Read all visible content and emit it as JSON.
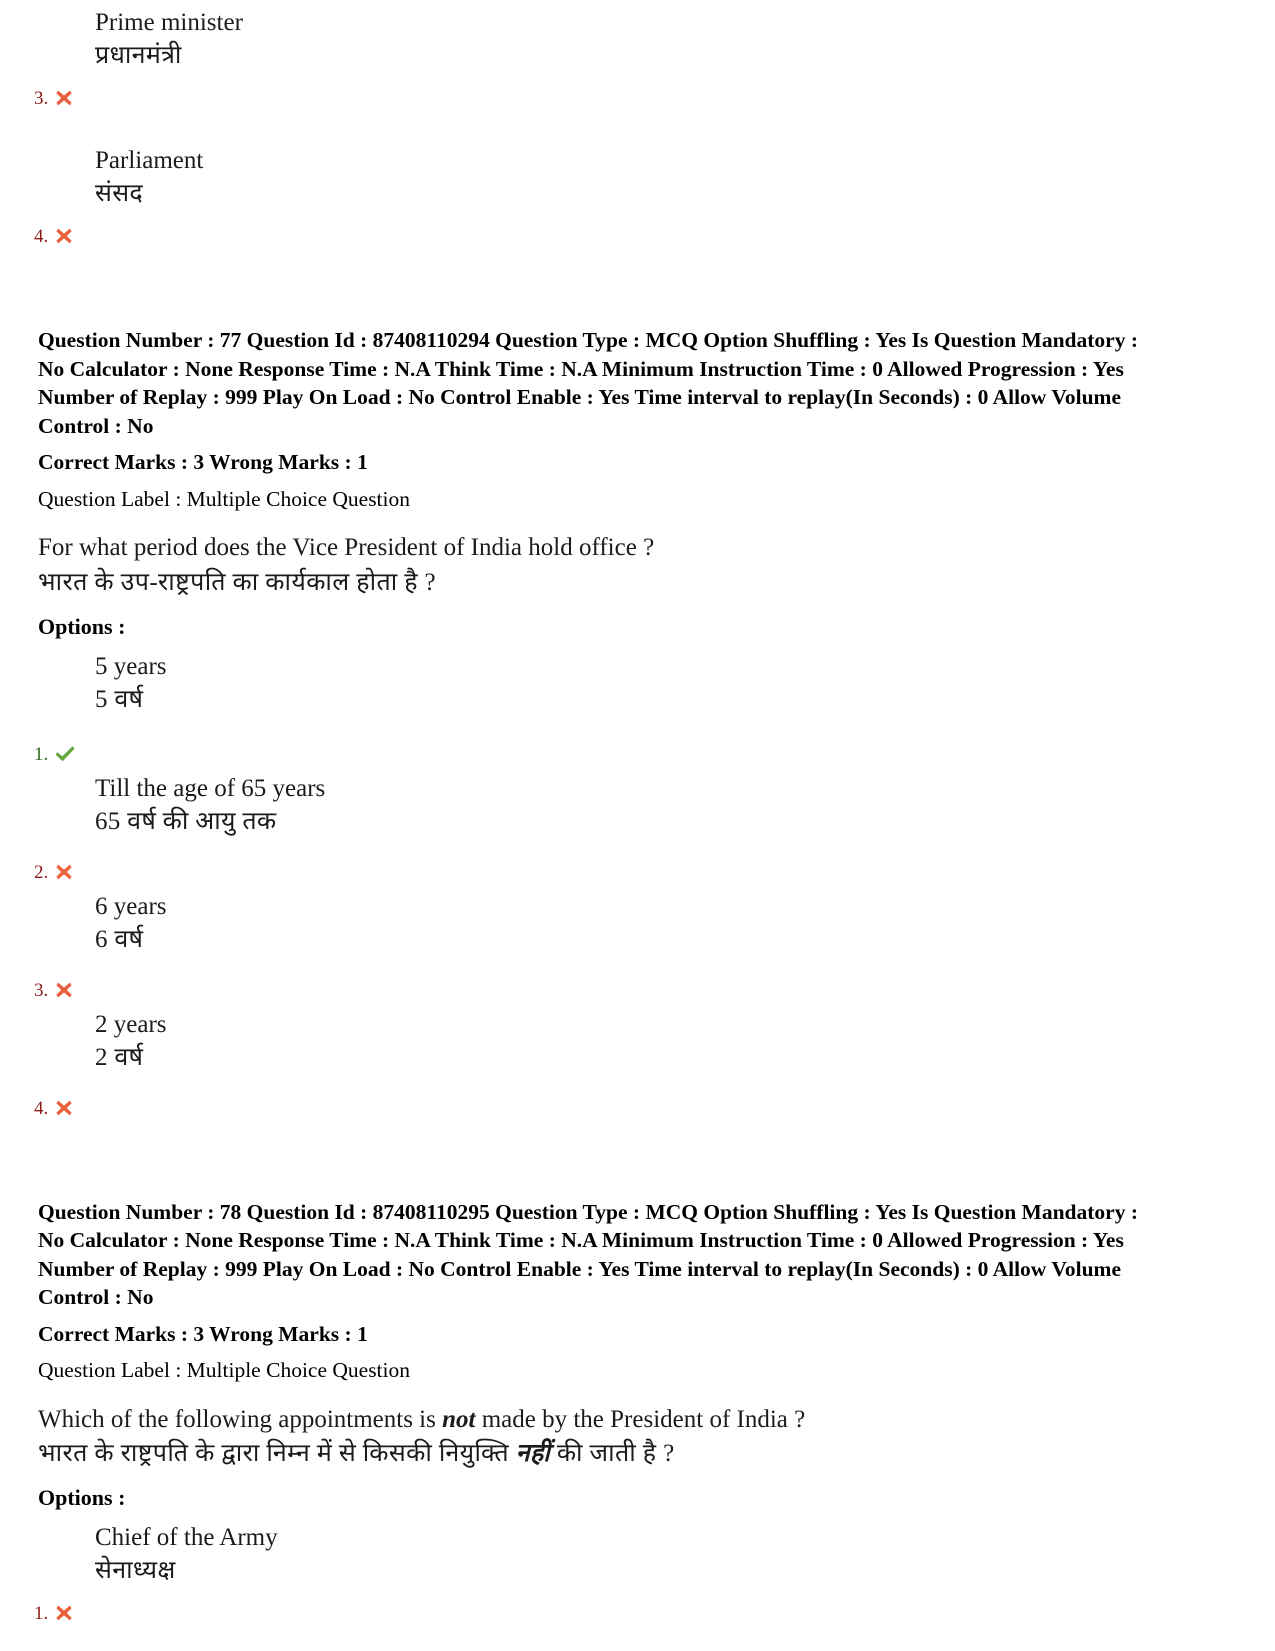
{
  "page": {
    "top_options_continued": [
      {
        "number": "3.",
        "status": "wrong",
        "icon": "cross-icon",
        "english": "Prime minister",
        "hindi": "प्रधानमंत्री"
      },
      {
        "number": "4.",
        "status": "wrong",
        "icon": "cross-icon",
        "english": "Parliament",
        "hindi": "संसद"
      }
    ],
    "questions": [
      {
        "meta_line": "Question Number : 77 Question Id : 87408110294 Question Type : MCQ Option Shuffling : Yes Is Question Mandatory : No Calculator : None Response Time : N.A Think Time : N.A Minimum Instruction Time : 0 Allowed Progression : Yes Number of Replay : 999 Play On Load : No Control Enable : Yes Time interval to replay(In Seconds) : 0 Allow Volume Control : No",
        "marks_line": "Correct Marks : 3 Wrong Marks : 1",
        "label_line": "Question Label : Multiple Choice Question",
        "question_en_before": "For what period does the Vice President of India hold office ?",
        "question_en_italic": "",
        "question_en_after": "",
        "question_hi_before": "भारत के उप-राष्ट्रपति का कार्यकाल होता है ?",
        "question_hi_italic": "",
        "question_hi_after": "",
        "options_heading": "Options :",
        "options": [
          {
            "number": "1.",
            "status": "correct",
            "icon": "check-icon",
            "english": "5 years",
            "hindi": "5 वर्ष"
          },
          {
            "number": "2.",
            "status": "wrong",
            "icon": "cross-icon",
            "english": "Till the age of 65 years",
            "hindi": "65 वर्ष की आयु तक"
          },
          {
            "number": "3.",
            "status": "wrong",
            "icon": "cross-icon",
            "english": "6 years",
            "hindi": "6 वर्ष"
          },
          {
            "number": "4.",
            "status": "wrong",
            "icon": "cross-icon",
            "english": "2 years",
            "hindi": "2 वर्ष"
          }
        ]
      },
      {
        "meta_line": "Question Number : 78 Question Id : 87408110295 Question Type : MCQ Option Shuffling : Yes Is Question Mandatory : No Calculator : None Response Time : N.A Think Time : N.A Minimum Instruction Time : 0 Allowed Progression : Yes Number of Replay : 999 Play On Load : No Control Enable : Yes Time interval to replay(In Seconds) : 0 Allow Volume Control : No",
        "marks_line": "Correct Marks : 3 Wrong Marks : 1",
        "label_line": "Question Label : Multiple Choice Question",
        "question_en_before": "Which of the following appointments is ",
        "question_en_italic": "not",
        "question_en_after": " made by the President of India ?",
        "question_hi_before": "भारत के राष्ट्रपति के द्वारा निम्न में से किसकी नियुक्ति ",
        "question_hi_italic": "नहीं",
        "question_hi_after": " की जाती है ?",
        "options_heading": "Options :",
        "options": [
          {
            "number": "1.",
            "status": "wrong",
            "icon": "cross-icon",
            "english": "Chief of the Army",
            "hindi": "सेनाध्यक्ष"
          }
        ]
      }
    ]
  },
  "colors": {
    "cross": "#e8603c",
    "check": "#62a83f",
    "wrong_number": "#8b1a1a",
    "correct_number": "#2e6b1f",
    "text": "#1b1b1b"
  }
}
